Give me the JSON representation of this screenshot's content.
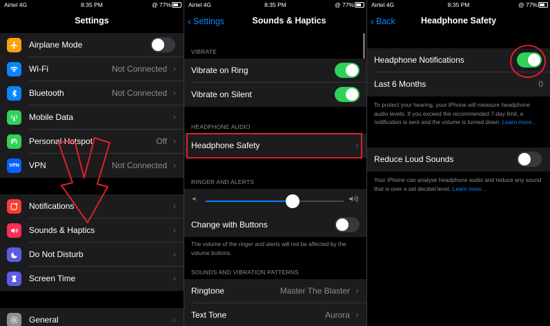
{
  "status_bar": {
    "carrier": "Airtel  4G",
    "time": "8:35 PM",
    "battery": "@ 77%"
  },
  "panel1": {
    "title": "Settings",
    "group1": [
      {
        "label": "Airplane Mode",
        "icon": "airplane-icon",
        "icon_color": "#ff9f0a",
        "toggle": false
      },
      {
        "label": "Wi-Fi",
        "icon": "wifi-icon",
        "icon_color": "#0a84ff",
        "value": "Not Connected"
      },
      {
        "label": "Bluetooth",
        "icon": "bluetooth-icon",
        "icon_color": "#0a84ff",
        "value": "Not Connected"
      },
      {
        "label": "Mobile Data",
        "icon": "antenna-icon",
        "icon_color": "#30d158",
        "value": ""
      },
      {
        "label": "Personal Hotspot",
        "icon": "hotspot-icon",
        "icon_color": "#30d158",
        "value": "Off"
      },
      {
        "label": "VPN",
        "icon": "vpn-icon",
        "icon_color": "#0a60ff",
        "icon_text": "VPN",
        "value": "Not Connected"
      }
    ],
    "group2": [
      {
        "label": "Notifications",
        "icon": "notifications-icon",
        "icon_color": "#ff3b30"
      },
      {
        "label": "Sounds & Haptics",
        "icon": "speaker-icon",
        "icon_color": "#ff2d55"
      },
      {
        "label": "Do Not Disturb",
        "icon": "moon-icon",
        "icon_color": "#5e5ce6"
      },
      {
        "label": "Screen Time",
        "icon": "hourglass-icon",
        "icon_color": "#5e5ce6"
      }
    ],
    "group3": [
      {
        "label": "General",
        "icon": "gear-icon",
        "icon_color": "#8e8e93"
      }
    ]
  },
  "panel2": {
    "back_label": "Settings",
    "title": "Sounds & Haptics",
    "vibrate_header": "VIBRATE",
    "vibrate_on_ring": "Vibrate on Ring",
    "vibrate_on_silent": "Vibrate on Silent",
    "headphone_header": "HEADPHONE AUDIO",
    "headphone_safety": "Headphone Safety",
    "ringer_header": "RINGER AND ALERTS",
    "ringer_volume": 0.63,
    "change_with_buttons": "Change with Buttons",
    "ringer_footer": "The volume of the ringer and alerts will not be affected by the volume buttons.",
    "patterns_header": "SOUNDS AND VIBRATION PATTERNS",
    "ringtone_label": "Ringtone",
    "ringtone_value": "Master The Blaster",
    "text_tone_label": "Text Tone",
    "text_tone_value": "Aurora"
  },
  "panel3": {
    "back_label": "Back",
    "title": "Headphone Safety",
    "headphone_notifications": "Headphone Notifications",
    "last_6_months": "Last 6 Months",
    "last_6_months_value": "0",
    "footer1_text": "To protect your hearing, your iPhone will measure headphone audio levels. If you exceed the recommended 7-day limit, a notification is sent and the volume is turned down.",
    "footer1_link": "Learn more...",
    "reduce_loud_sounds": "Reduce Loud Sounds",
    "footer2_text": "Your iPhone can analyse headphone audio and reduce any sound that is over a set decibel level.",
    "footer2_link": "Learn more..."
  },
  "colors": {
    "accent": "#0a84ff",
    "toggle_on": "#30d158",
    "highlight": "#e0212b"
  }
}
